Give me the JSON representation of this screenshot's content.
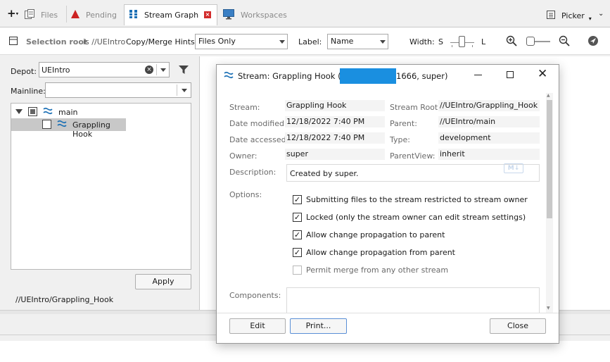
{
  "tabs": [
    {
      "id": "files",
      "label": "Files",
      "icon": "files-icon"
    },
    {
      "id": "pending",
      "label": "Pending",
      "icon": "pending-icon"
    },
    {
      "id": "stream_graph",
      "label": "Stream Graph",
      "icon": "stream-graph-icon",
      "active": true
    },
    {
      "id": "workspaces",
      "label": "Workspaces",
      "icon": "workspaces-icon"
    }
  ],
  "picker_label": "Picker",
  "toolbar": {
    "selection_root_label": "Selection root",
    "selection_root_value": "is //UEIntro",
    "copy_merge_label": "Copy/Merge Hints:",
    "copy_merge_value": "Files Only",
    "label_label": "Label:",
    "label_value": "Name",
    "width_label": "Width:",
    "width_small": "S",
    "width_large": "L"
  },
  "left": {
    "depot_label": "Depot:",
    "depot_value": "UEIntro",
    "mainline_label": "Mainline:",
    "mainline_value": "",
    "tree": [
      {
        "label": "main",
        "level": 0
      },
      {
        "label": "Grappling Hook",
        "level": 1,
        "selected": true
      }
    ],
    "apply_label": "Apply",
    "path": "//UEIntro/Grappling_Hook"
  },
  "dialog": {
    "title_prefix": "Stream: Grappling Hook (ss",
    "title_suffix": "1666,  super)",
    "fields": {
      "stream_label": "Stream:",
      "stream_value": "Grappling Hook",
      "stream_root_label": "Stream Root:",
      "stream_root_value": "//UEIntro/Grappling_Hook",
      "date_modified_label": "Date modified:",
      "date_modified_value": "12/18/2022 7:40 PM",
      "parent_label": "Parent:",
      "parent_value": "//UEIntro/main",
      "date_accessed_label": "Date accessed:",
      "date_accessed_value": "12/18/2022 7:40 PM",
      "type_label": "Type:",
      "type_value": "development",
      "owner_label": "Owner:",
      "owner_value": "super",
      "parentview_label": "ParentView:",
      "parentview_value": "inherit",
      "description_label": "Description:",
      "description_value": "Created by super."
    },
    "options_label": "Options:",
    "options": [
      {
        "label": "Submitting files to the stream restricted to stream owner",
        "checked": true
      },
      {
        "label": "Locked (only the stream owner can edit stream settings)",
        "checked": true
      },
      {
        "label": "Allow change propagation to parent",
        "checked": true
      },
      {
        "label": "Allow change propagation from parent",
        "checked": true
      },
      {
        "label": "Permit merge from any other stream",
        "checked": false
      }
    ],
    "components_label": "Components:",
    "buttons": {
      "edit": "Edit",
      "print": "Print...",
      "close": "Close"
    }
  },
  "colors": {
    "accent": "#1a6fb5",
    "redaction": "#1a8fe0",
    "pending_red": "#cc2222",
    "tab_close": "#d22b2b"
  }
}
